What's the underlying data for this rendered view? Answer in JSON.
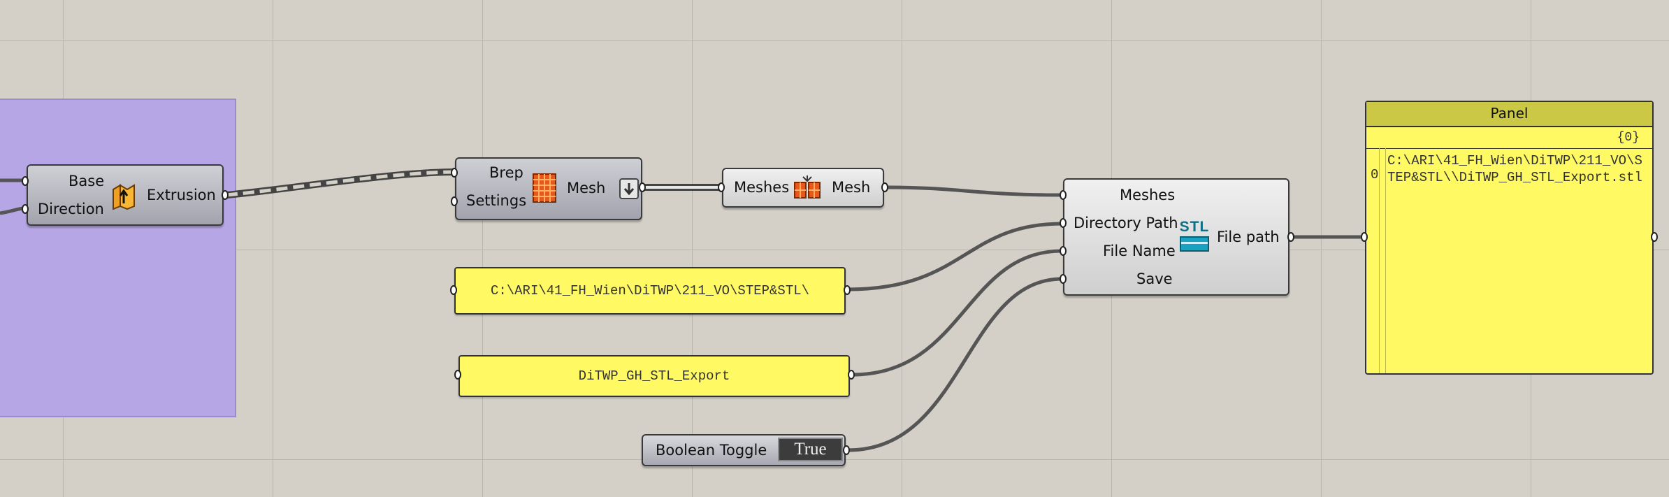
{
  "components": {
    "extrusion": {
      "inputs": [
        "Base",
        "Direction"
      ],
      "output": "Extrusion",
      "icon": "extrusion-icon"
    },
    "mesh_brep": {
      "inputs": [
        "Brep",
        "Settings"
      ],
      "output": "Mesh",
      "icon": "mesh-brep-icon"
    },
    "mesh_join": {
      "input": "Meshes",
      "output": "Mesh",
      "icon": "mesh-join-icon"
    },
    "stl_export": {
      "inputs": [
        "Meshes",
        "Directory Path",
        "File Name",
        "Save"
      ],
      "output": "File path",
      "icon_text": "STL"
    },
    "boolean_toggle": {
      "label": "Boolean Toggle",
      "value": "True"
    }
  },
  "panels": {
    "directory": "C:\\ARI\\41_FH_Wien\\DiTWP\\211_VO\\STEP&STL\\",
    "filename": "DiTWP_GH_STL_Export",
    "output_panel": {
      "title": "Panel",
      "path": "{0}",
      "index": "0",
      "text": "C:\\ARI\\41_FH_Wien\\DiTWP\\211_VO\\STEP&STL\\\\DiTWP_GH_STL_Export.stl"
    }
  },
  "colors": {
    "canvas": "#d4d0c8",
    "group": "#b7a6e6",
    "panel_yellow": "#fff964",
    "wire": "#555555"
  }
}
